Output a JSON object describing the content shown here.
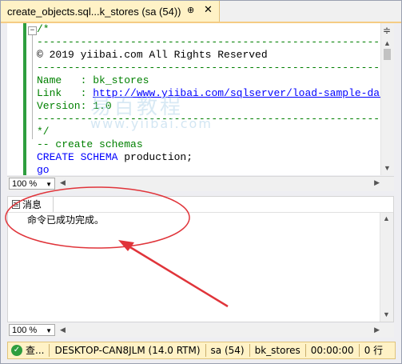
{
  "tab": {
    "title": "create_objects.sql...k_stores (sa (54))",
    "pin_icon": "pin-icon",
    "close_icon": "close-icon"
  },
  "editor": {
    "lines": [
      {
        "parts": [
          {
            "text": "/*",
            "cls": "c-green"
          }
        ]
      },
      {
        "parts": [
          {
            "text": "--------------------------------------------------------------------------",
            "cls": "c-green"
          }
        ]
      },
      {
        "parts": [
          {
            "text": "© 2019 yiibai.com All Rights Reserved",
            "cls": "c-black"
          }
        ]
      },
      {
        "parts": [
          {
            "text": "--------------------------------------------------------------------------",
            "cls": "c-green"
          }
        ]
      },
      {
        "parts": [
          {
            "text": "Name   : bk_stores",
            "cls": "c-green"
          }
        ]
      },
      {
        "parts": [
          {
            "text": "Link   : ",
            "cls": "c-green"
          },
          {
            "text": "http://www.yiibai.com/sqlserver/load-sample-database.",
            "cls": "c-link"
          }
        ]
      },
      {
        "parts": [
          {
            "text": "Version: 1.0",
            "cls": "c-green"
          }
        ]
      },
      {
        "parts": [
          {
            "text": "--------------------------------------------------------------------------",
            "cls": "c-green"
          }
        ]
      },
      {
        "parts": [
          {
            "text": "*/",
            "cls": "c-green"
          }
        ]
      },
      {
        "parts": [
          {
            "text": "-- create schemas",
            "cls": "c-green"
          }
        ]
      },
      {
        "parts": [
          {
            "text": "CREATE SCHEMA",
            "cls": "c-blue"
          },
          {
            "text": " production",
            "cls": "c-black"
          },
          {
            "text": ";",
            "cls": "c-black"
          }
        ]
      },
      {
        "parts": [
          {
            "text": "go",
            "cls": "c-blue"
          }
        ]
      }
    ],
    "outline_toggle": "−",
    "zoom": "100 %",
    "watermark_line1": "易百教程",
    "watermark_line2": "www.yiibai.com"
  },
  "results": {
    "tab_label": "消息",
    "message": "命令已成功完成。",
    "zoom": "100 %"
  },
  "status": {
    "state": "查...",
    "server": "DESKTOP-CAN8JLM (14.0 RTM)",
    "user": "sa (54)",
    "database": "bk_stores",
    "elapsed": "00:00:00",
    "rows": "0 行"
  },
  "colors": {
    "status_bg": "#fff2c6",
    "annotation": "#e0343a",
    "tab_bg": "#fff2c6"
  }
}
